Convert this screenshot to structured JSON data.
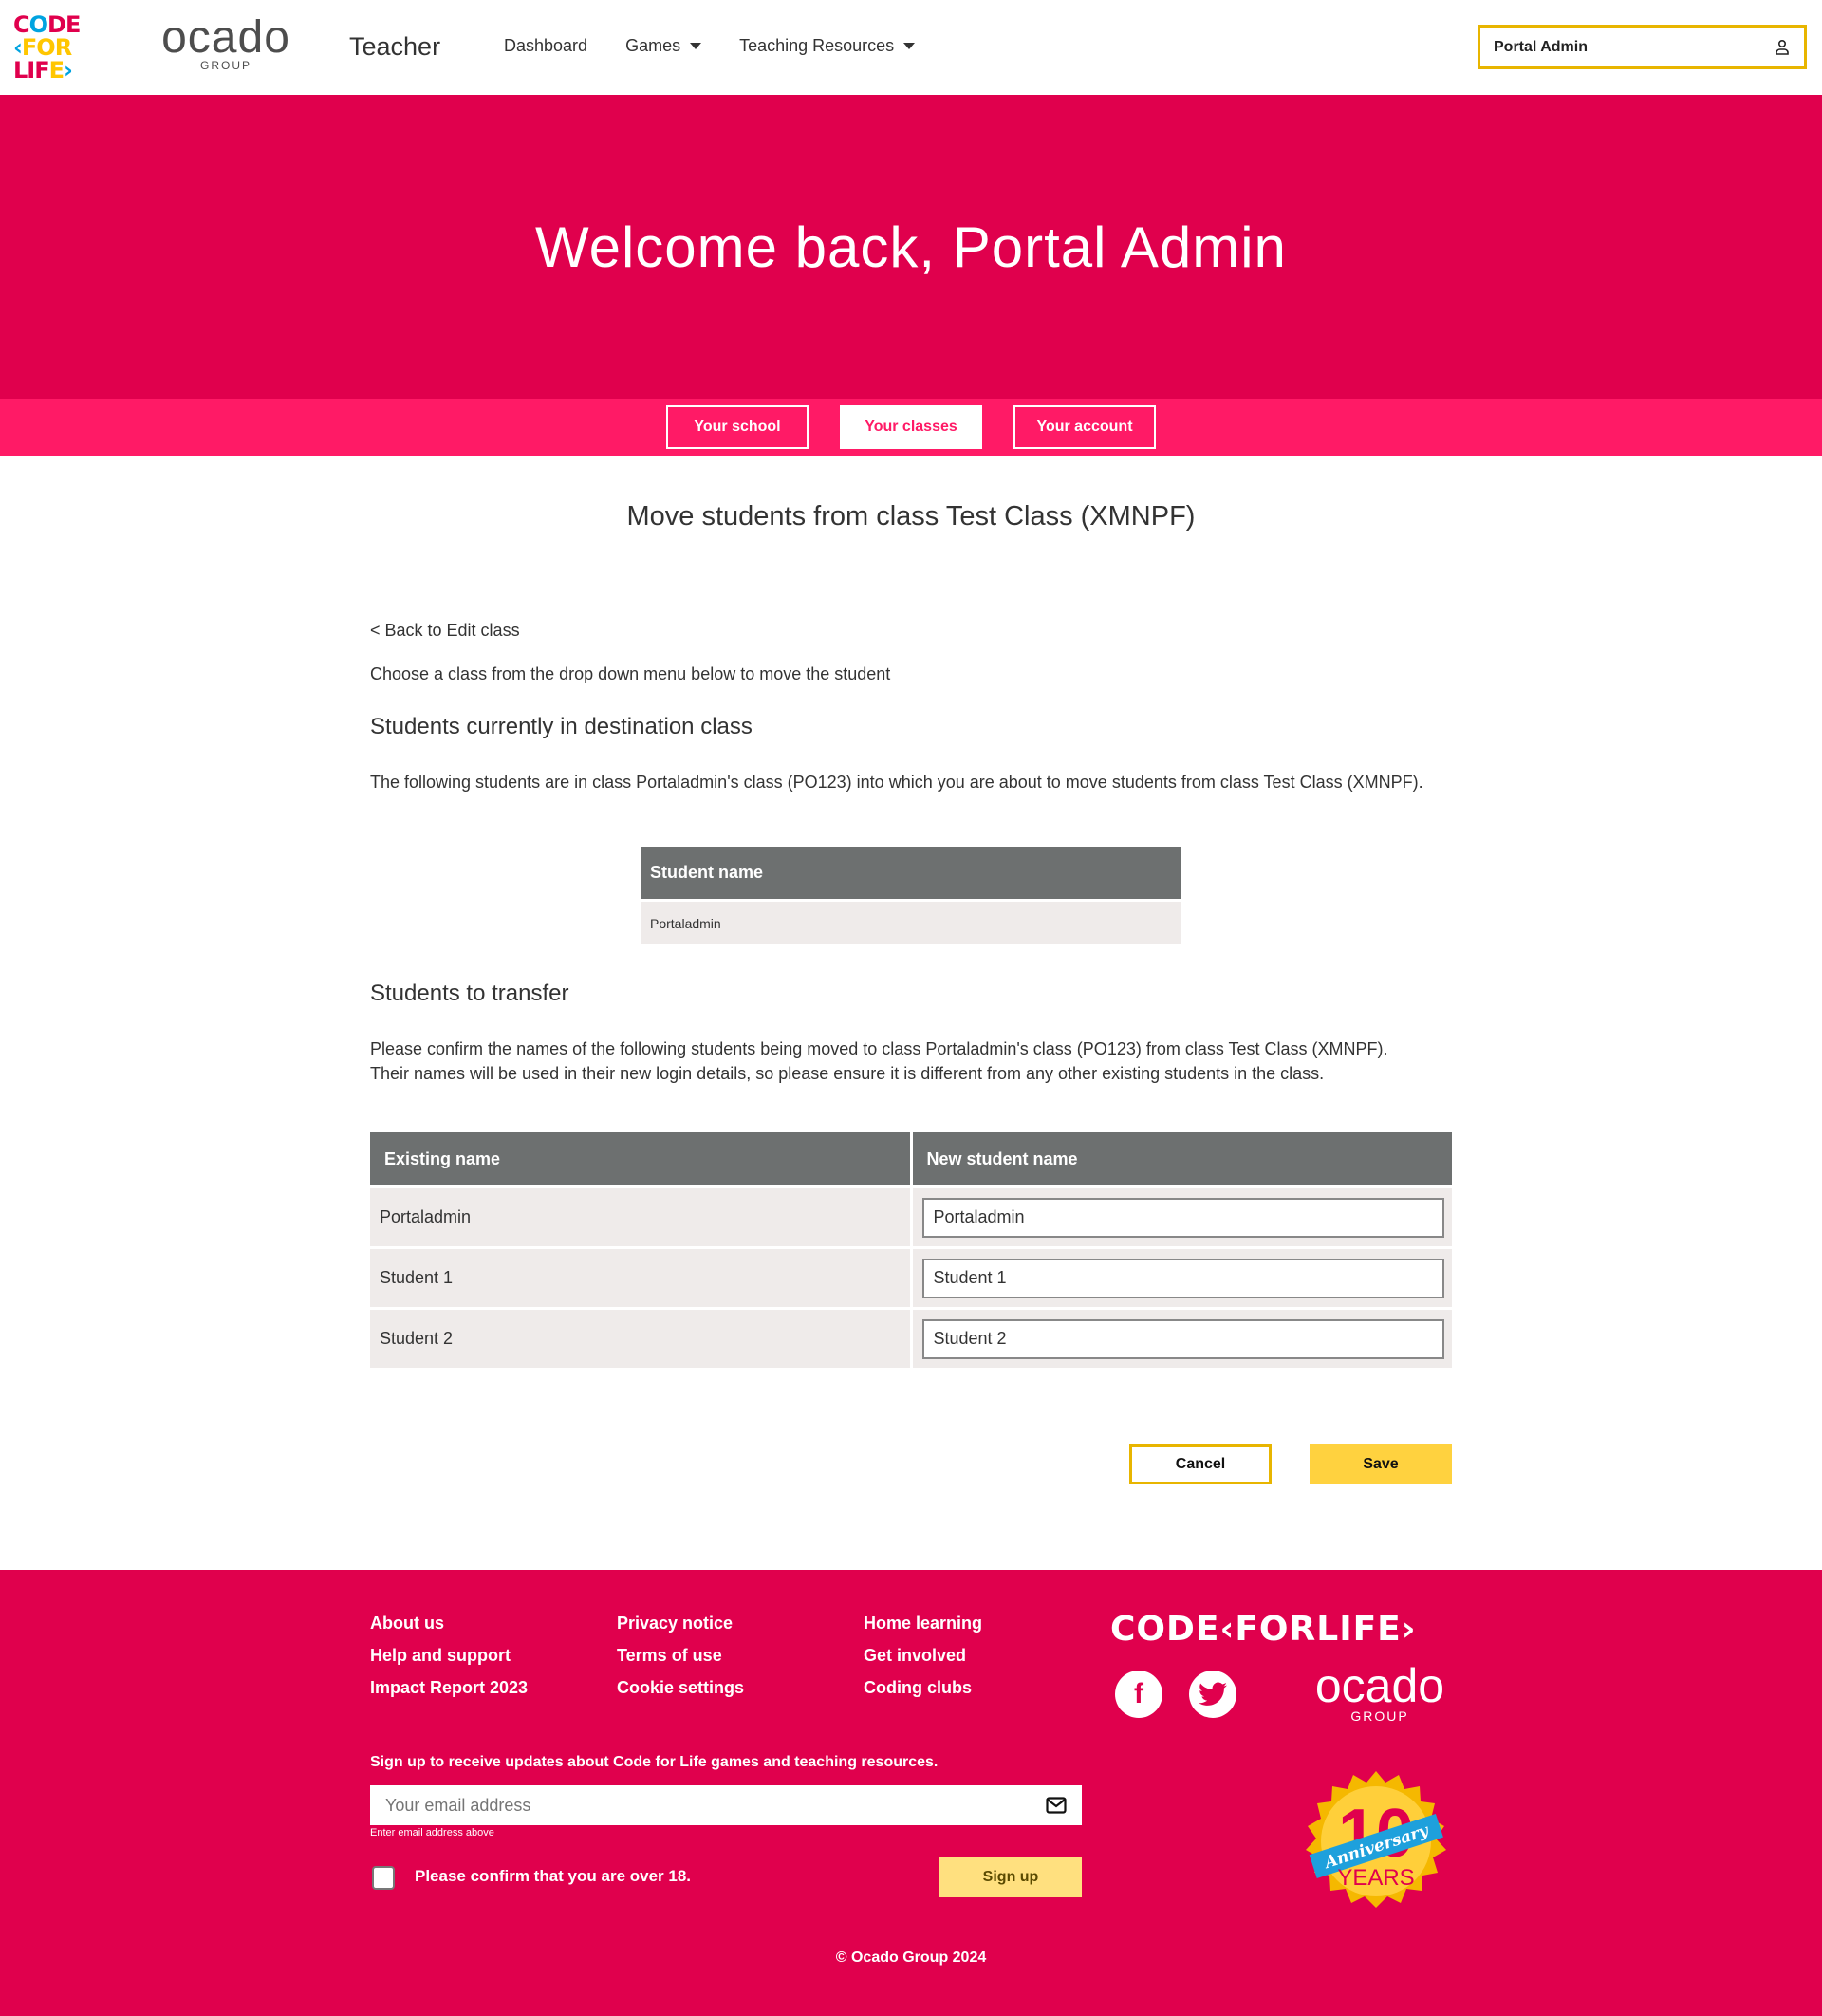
{
  "header": {
    "logo_alt": "Code for Life",
    "ocado_word": "ocado",
    "ocado_group": "GROUP",
    "app_title": "Teacher",
    "nav": [
      {
        "label": "Dashboard",
        "dropdown": false
      },
      {
        "label": "Games",
        "dropdown": true
      },
      {
        "label": "Teaching Resources",
        "dropdown": true
      }
    ],
    "user_name": "Portal Admin",
    "user_icon": "person-icon"
  },
  "hero": {
    "title": "Welcome back, Portal Admin"
  },
  "subnav": {
    "tabs": [
      {
        "label": "Your school",
        "active": false
      },
      {
        "label": "Your classes",
        "active": true
      },
      {
        "label": "Your account",
        "active": false
      }
    ]
  },
  "main": {
    "page_title": "Move students from class Test Class (XMNPF)",
    "back_link": "< Back to Edit class",
    "intro": "Choose a class from the drop down menu below to move the student",
    "destination": {
      "heading": "Students currently in destination class",
      "description": "The following students are in class Portaladmin's class (PO123) into which you are about to move students from class Test Class (XMNPF).",
      "table_header": "Student name",
      "students": [
        "Portaladmin"
      ]
    },
    "transfer": {
      "heading": "Students to transfer",
      "description_line1": "Please confirm the names of the following students being moved to class Portaladmin's class (PO123) from class Test Class (XMNPF).",
      "description_line2": "Their names will be used in their new login details, so please ensure it is different from any other existing students in the class.",
      "columns": [
        "Existing name",
        "New student name"
      ],
      "rows": [
        {
          "existing": "Portaladmin",
          "new_name": "Portaladmin"
        },
        {
          "existing": "Student 1",
          "new_name": "Student 1"
        },
        {
          "existing": "Student 2",
          "new_name": "Student 2"
        }
      ]
    },
    "cancel_label": "Cancel",
    "save_label": "Save"
  },
  "footer": {
    "links": [
      "About us",
      "Privacy notice",
      "Home learning",
      "Help and support",
      "Terms of use",
      "Get involved",
      "Impact Report 2023",
      "Cookie settings",
      "Coding clubs"
    ],
    "brand": "CODE‹FORLIFE›",
    "ocado_word": "ocado",
    "ocado_group": "GROUP",
    "signup_text": "Sign up to receive updates about Code for Life games and teaching resources.",
    "email_placeholder": "Your email address",
    "email_hint": "Enter email address above",
    "age_confirm": "Please confirm that you are over 18.",
    "signup_label": "Sign up",
    "badge_number": "10",
    "badge_ribbon": "Anniversary",
    "badge_years": "YEARS",
    "copyright": "© Ocado Group 2024"
  },
  "colors": {
    "brand_pink": "#e0004d",
    "subnav_pink": "#ff1a66",
    "accent_yellow": "#ffd23f",
    "table_header": "#6d7070",
    "table_row": "#efebea"
  }
}
